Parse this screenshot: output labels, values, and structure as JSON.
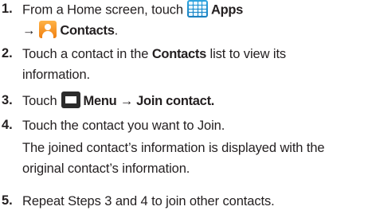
{
  "steps": [
    {
      "number": "1.",
      "line1_prefix": "From a Home screen, touch",
      "line1_bold": "Apps",
      "line2_arrow": "→",
      "line2_bold": "Contacts",
      "line2_suffix": ".",
      "icons": [
        "apps-grid-icon",
        "contacts-icon"
      ]
    },
    {
      "number": "2.",
      "line1_prefix": "Touch a contact in the",
      "line1_bold": "Contacts",
      "line1_suffix": "list to view its",
      "line2": "information."
    },
    {
      "number": "3.",
      "prefix": "Touch",
      "bold": "Menu → Join contact.",
      "icons": [
        "menu-icon"
      ]
    },
    {
      "number": "4.",
      "line1": "Touch the contact you want to Join.",
      "line2": "The joined contact’s information is displayed with the",
      "line3": "original contact’s information."
    },
    {
      "number": "5.",
      "line1": "Repeat Steps 3 and 4 to join other contacts."
    }
  ],
  "colors": {
    "text": "#231f20",
    "apps_icon": "#1a7fc0",
    "contacts_icon": "#f07f10",
    "menu_icon": "#2b2b2b"
  }
}
